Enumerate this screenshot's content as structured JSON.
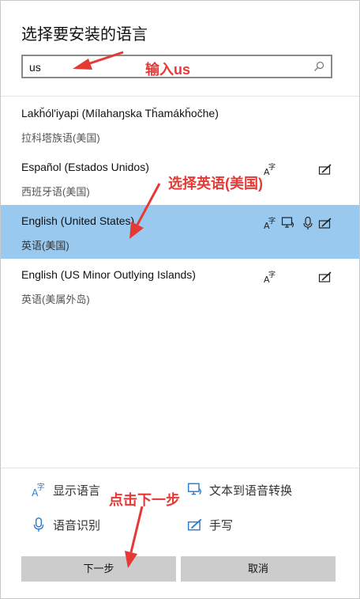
{
  "dialog": {
    "title": "选择要安装的语言"
  },
  "search": {
    "value": "us",
    "icon": "search-icon"
  },
  "languages": [
    {
      "name": "Lakȟól'iyapi (Mílahaŋska Tȟamákȟočhe)",
      "native": "拉科塔族语(美国)",
      "selected": false,
      "features": []
    },
    {
      "name": "Español (Estados Unidos)",
      "native": "西班牙语(美国)",
      "selected": false,
      "features": [
        "display-language-icon",
        "handwriting-icon"
      ]
    },
    {
      "name": "English (United States)",
      "native": "英语(美国)",
      "selected": true,
      "features": [
        "display-language-icon",
        "text-to-speech-icon",
        "speech-recognition-icon",
        "handwriting-icon"
      ]
    },
    {
      "name": "English (US Minor Outlying Islands)",
      "native": "英语(美属外岛)",
      "selected": false,
      "features": [
        "display-language-icon",
        "handwriting-icon"
      ]
    }
  ],
  "legend": {
    "display_language": "显示语言",
    "text_to_speech": "文本到语音转换",
    "speech_recognition": "语音识别",
    "handwriting": "手写"
  },
  "buttons": {
    "next": "下一步",
    "cancel": "取消"
  },
  "annotations": {
    "type_us": "输入us",
    "select_english": "选择英语(美国)",
    "click_next": "点击下一步"
  },
  "colors": {
    "selected_row": "#99c9ee",
    "annotation": "#e53935",
    "icon_blue": "#2b7cd3",
    "button_gray": "#cccccc"
  }
}
